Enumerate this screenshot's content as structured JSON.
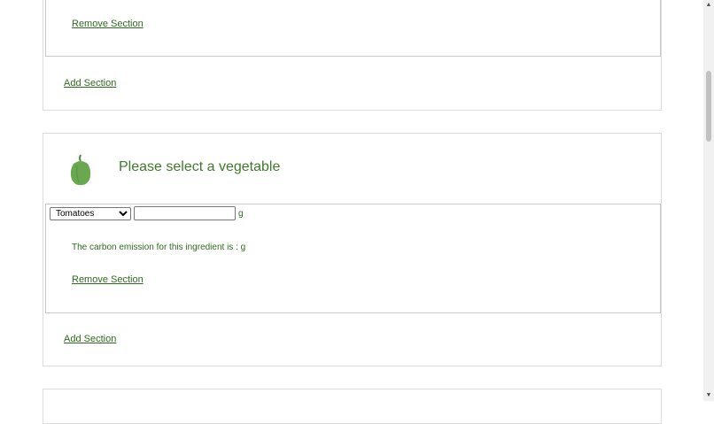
{
  "section_top": {
    "remove_label": "Remove Section",
    "add_label": "Add Section"
  },
  "section_vegetable": {
    "title": "Please select a vegetable",
    "icon": "pepper-icon",
    "select": {
      "selected": "Tomatoes",
      "options": [
        "Tomatoes"
      ]
    },
    "quantity_value": "",
    "unit": "g",
    "emission_text": "The carbon emission for this ingredient is : g",
    "remove_label": "Remove Section",
    "add_label": "Add Section"
  },
  "colors": {
    "accent_green": "#2f6b1f",
    "icon_green": "#6aa84f"
  }
}
